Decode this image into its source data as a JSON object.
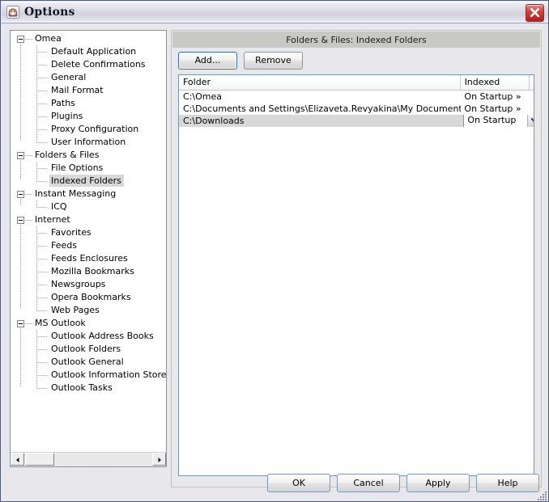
{
  "window": {
    "title": "Options",
    "icon": "omea-app-icon",
    "close_label": "×"
  },
  "sidebar": {
    "name": "options-category-tree",
    "items": [
      {
        "label": "Omea",
        "level": "root",
        "expanded": true,
        "selected": false
      },
      {
        "label": "Default Application",
        "level": "child",
        "selected": false
      },
      {
        "label": "Delete Confirmations",
        "level": "child",
        "selected": false
      },
      {
        "label": "General",
        "level": "child",
        "selected": false
      },
      {
        "label": "Mail Format",
        "level": "child",
        "selected": false
      },
      {
        "label": "Paths",
        "level": "child",
        "selected": false
      },
      {
        "label": "Plugins",
        "level": "child",
        "selected": false
      },
      {
        "label": "Proxy Configuration",
        "level": "child",
        "selected": false
      },
      {
        "label": "User Information",
        "level": "child",
        "selected": false,
        "last": true
      },
      {
        "label": "Folders & Files",
        "level": "root",
        "expanded": true,
        "selected": false
      },
      {
        "label": "File Options",
        "level": "child",
        "selected": false
      },
      {
        "label": "Indexed Folders",
        "level": "child",
        "selected": true,
        "last": true
      },
      {
        "label": "Instant Messaging",
        "level": "root",
        "expanded": true,
        "selected": false
      },
      {
        "label": "ICQ",
        "level": "child",
        "selected": false,
        "last": true
      },
      {
        "label": "Internet",
        "level": "root",
        "expanded": true,
        "selected": false
      },
      {
        "label": "Favorites",
        "level": "child",
        "selected": false
      },
      {
        "label": "Feeds",
        "level": "child",
        "selected": false
      },
      {
        "label": "Feeds Enclosures",
        "level": "child",
        "selected": false
      },
      {
        "label": "Mozilla Bookmarks",
        "level": "child",
        "selected": false
      },
      {
        "label": "Newsgroups",
        "level": "child",
        "selected": false
      },
      {
        "label": "Opera Bookmarks",
        "level": "child",
        "selected": false
      },
      {
        "label": "Web Pages",
        "level": "child",
        "selected": false,
        "last": true
      },
      {
        "label": "MS Outlook",
        "level": "root",
        "expanded": true,
        "selected": false
      },
      {
        "label": "Outlook Address Books",
        "level": "child",
        "selected": false
      },
      {
        "label": "Outlook Folders",
        "level": "child",
        "selected": false
      },
      {
        "label": "Outlook General",
        "level": "child",
        "selected": false
      },
      {
        "label": "Outlook Information Stores",
        "level": "child",
        "selected": false
      },
      {
        "label": "Outlook Tasks",
        "level": "child",
        "selected": false,
        "last": true
      }
    ]
  },
  "page": {
    "header": "Folders & Files: Indexed Folders",
    "toolbar": {
      "add_label": "Add...",
      "remove_label": "Remove"
    },
    "list": {
      "columns": [
        "Folder",
        "Indexed"
      ],
      "rows": [
        {
          "folder": "C:\\Omea",
          "indexed": "On Startup »",
          "selected": false,
          "editing": false
        },
        {
          "folder": "C:\\Documents and Settings\\Elizaveta.Revyakina\\My Documents",
          "indexed": "On Startup »",
          "selected": false,
          "editing": false
        },
        {
          "folder": "C:\\Downloads",
          "indexed": "On Startup",
          "selected": true,
          "editing": true
        }
      ]
    }
  },
  "footer": {
    "ok_label": "OK",
    "cancel_label": "Cancel",
    "apply_label": "Apply",
    "help_label": "Help"
  },
  "colors": {
    "window_border": "#4f5b7a",
    "page_header_bg": "#c8c8c4",
    "selection_bg": "#d8d8d8",
    "field_border": "#7b96b4",
    "close_red": "#d6403c"
  }
}
